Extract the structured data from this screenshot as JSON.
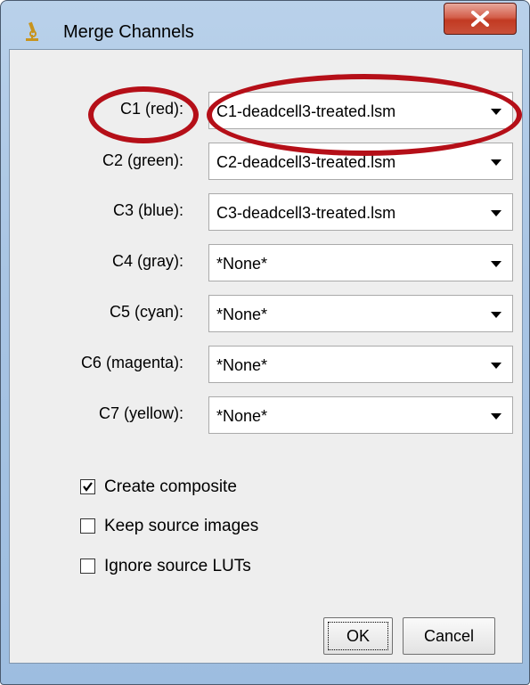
{
  "window": {
    "title": "Merge Channels",
    "app_icon": "imagej-microscope-icon",
    "close_icon": "close-x-icon"
  },
  "channels": [
    {
      "label": "C1 (red):",
      "value": "C1-deadcell3-treated.lsm"
    },
    {
      "label": "C2 (green):",
      "value": "C2-deadcell3-treated.lsm"
    },
    {
      "label": "C3 (blue):",
      "value": "C3-deadcell3-treated.lsm"
    },
    {
      "label": "C4 (gray):",
      "value": "*None*"
    },
    {
      "label": "C5 (cyan):",
      "value": "*None*"
    },
    {
      "label": "C6 (magenta):",
      "value": "*None*"
    },
    {
      "label": "C7 (yellow):",
      "value": "*None*"
    }
  ],
  "options": [
    {
      "label": "Create composite",
      "checked": true
    },
    {
      "label": "Keep source images",
      "checked": false
    },
    {
      "label": "Ignore source LUTs",
      "checked": false
    }
  ],
  "buttons": {
    "ok": "OK",
    "cancel": "Cancel"
  },
  "colors": {
    "annotation": "#b50f18",
    "close_button": "#c23a22",
    "dialog_bg": "#eeeeee"
  }
}
